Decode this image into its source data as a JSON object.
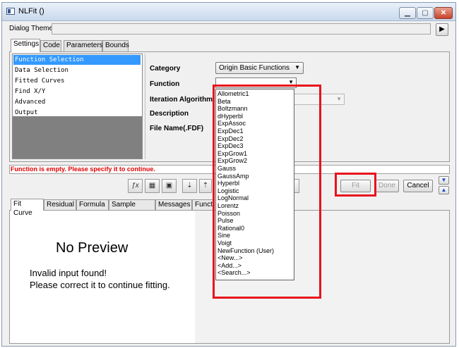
{
  "window": {
    "title": "NLFit ()"
  },
  "dialog_theme": {
    "label": "Dialog Theme",
    "value": "",
    "arrow": "▶"
  },
  "tabs": [
    {
      "label": "Settings"
    },
    {
      "label": "Code"
    },
    {
      "label": "Parameters"
    },
    {
      "label": "Bounds"
    }
  ],
  "tree": [
    {
      "label": "Function Selection",
      "selected": true
    },
    {
      "label": "Data Selection"
    },
    {
      "label": "Fitted Curves"
    },
    {
      "label": "Find X/Y"
    },
    {
      "label": "Advanced"
    },
    {
      "label": "Output"
    }
  ],
  "form": {
    "category_label": "Category",
    "category_value": "Origin Basic Functions",
    "function_label": "Function",
    "function_value": "",
    "iteration_label": "Iteration Algorithm",
    "description_label": "Description",
    "filename_label": "File Name(.FDF)"
  },
  "dropdown": {
    "items": [
      "Allometric1",
      "Beta",
      "Boltzmann",
      "dHyperbl",
      "ExpAssoc",
      "ExpDec1",
      "ExpDec2",
      "ExpDec3",
      "ExpGrow1",
      "ExpGrow2",
      "Gauss",
      "GaussAmp",
      "Hyperbl",
      "Logistic",
      "LogNormal",
      "Lorentz",
      "Poisson",
      "Pulse",
      "Rational0",
      "Sine",
      "Voigt",
      "NewFunction (User)",
      "<New...>",
      "<Add...>",
      "<Search...>"
    ]
  },
  "status": {
    "message": "Function is empty. Please specify it to continue."
  },
  "buttons": {
    "fit": "Fit",
    "done": "Done",
    "cancel": "Cancel"
  },
  "bottom_tabs": [
    {
      "label": "Fit Curve"
    },
    {
      "label": "Residual"
    },
    {
      "label": "Formula"
    },
    {
      "label": "Sample Curve"
    },
    {
      "label": "Messages"
    },
    {
      "label": "Functi"
    }
  ],
  "preview": {
    "title": "No Preview",
    "line1": "Invalid input found!",
    "line2": "Please correct it to continue fitting."
  },
  "colors": {
    "highlight_red": "#e8121c",
    "status_red": "#e00000",
    "selection_blue": "#3399ff"
  }
}
